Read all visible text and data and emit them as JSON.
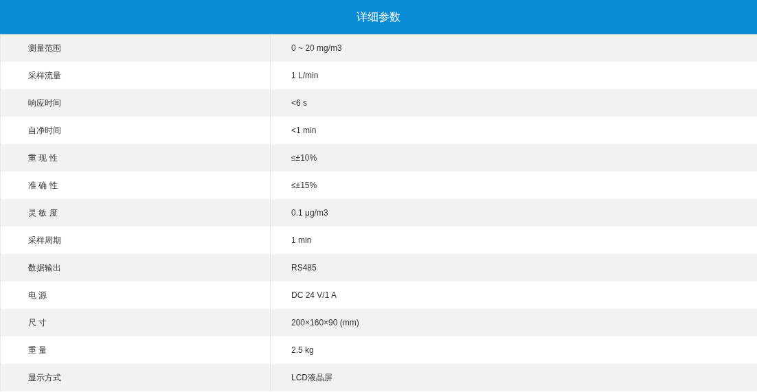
{
  "title": "详细参数",
  "rows": [
    {
      "label": "测量范围",
      "value": "0 ~ 20 mg/m3"
    },
    {
      "label": "采样流量",
      "value": "1 L/min"
    },
    {
      "label": "响应时间",
      "value": "<6 s"
    },
    {
      "label": "自净时间",
      "value": "<1 min"
    },
    {
      "label": "重 现 性",
      "value": "≤±10%"
    },
    {
      "label": "准 确 性",
      "value": "≤±15%"
    },
    {
      "label": "灵 敏 度",
      "value": "0.1 μg/m3"
    },
    {
      "label": "采样周期",
      "value": "1 min"
    },
    {
      "label": "数据输出",
      "value": "RS485"
    },
    {
      "label": "电 源",
      "value": "DC 24 V/1 A"
    },
    {
      "label": "尺 寸",
      "value": "200×160×90 (mm)"
    },
    {
      "label": "重 量",
      "value": "2.5 kg"
    },
    {
      "label": "显示方式",
      "value": "LCD液晶屏"
    }
  ]
}
